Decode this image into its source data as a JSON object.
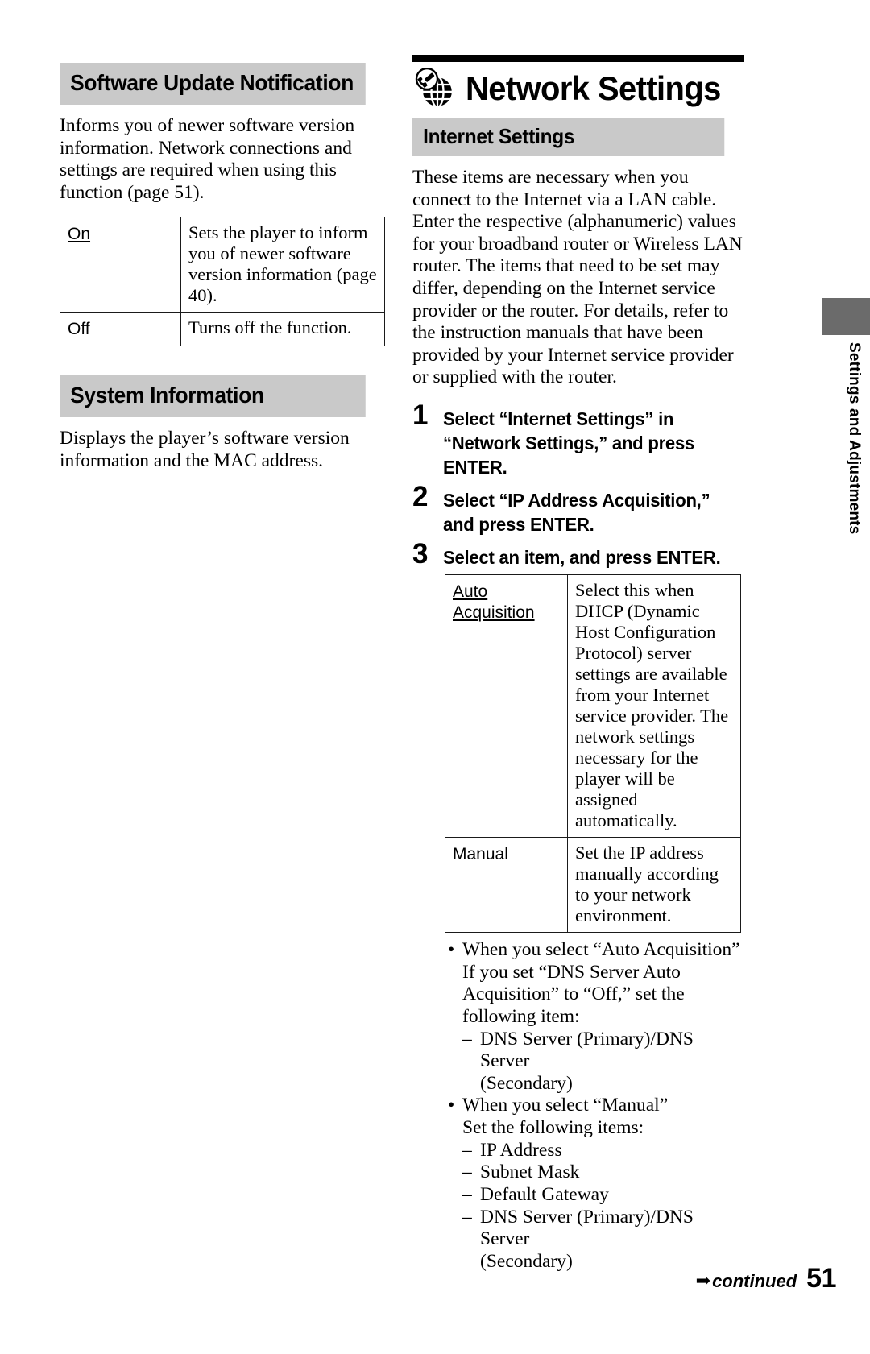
{
  "page": {
    "number": "51",
    "continued_label": "continued",
    "arrow_icon": "right-arrow-icon"
  },
  "side_tab": {
    "label": "Settings and Adjustments",
    "block_color": "#6b6b6b"
  },
  "left_column": {
    "sections": [
      {
        "heading": "Software Update Notification",
        "body": "Informs you of newer software version information. Network connections and settings are required when using this function (page 51).",
        "table": [
          {
            "key": "On",
            "key_is_default": true,
            "value": "Sets the player to inform you of newer software version information (page 40)."
          },
          {
            "key": "Off",
            "key_is_default": false,
            "value": "Turns off the function."
          }
        ]
      },
      {
        "heading": "System Information",
        "body": "Displays the player’s software version information and the MAC address."
      }
    ]
  },
  "right_column": {
    "chapter": {
      "icon": "network-settings-globe-wrench-icon",
      "title": "Network Settings"
    },
    "section_heading": "Internet Settings",
    "intro": "These items are necessary when you connect to the Internet via a LAN cable. Enter the respective (alphanumeric) values for your broadband router or Wireless LAN router. The items that need to be set may differ, depending on the Internet service provider or the router. For details, refer to the instruction manuals that have been provided by your Internet service provider or supplied with the router.",
    "steps": [
      {
        "num": "1",
        "text": "Select “Internet Settings” in “Network Settings,” and press ENTER."
      },
      {
        "num": "2",
        "text": "Select “IP Address Acquisition,” and press ENTER."
      },
      {
        "num": "3",
        "text": "Select an item, and press ENTER."
      }
    ],
    "table": [
      {
        "key": "Auto Acquisition",
        "key_is_default": true,
        "value": "Select this when DHCP (Dynamic Host Configuration Protocol) server settings are available from your Internet service provider. The network settings necessary for the player will be assigned automatically."
      },
      {
        "key": "Manual",
        "key_is_default": false,
        "value": "Set the IP address manually according to your network environment."
      }
    ],
    "notes": [
      {
        "bullet": "When you select “Auto Acquisition”",
        "sub": "If you set “DNS Server Auto Acquisition” to “Off,” set the following item:",
        "dashes": [
          {
            "main": "DNS Server (Primary)/DNS Server",
            "cont": "(Secondary)"
          }
        ]
      },
      {
        "bullet": "When you select “Manual”",
        "sub": "Set the following items:",
        "dashes": [
          {
            "main": "IP Address",
            "cont": ""
          },
          {
            "main": "Subnet Mask",
            "cont": ""
          },
          {
            "main": "Default Gateway",
            "cont": ""
          },
          {
            "main": "DNS Server (Primary)/DNS Server",
            "cont": "(Secondary)"
          }
        ]
      }
    ]
  }
}
